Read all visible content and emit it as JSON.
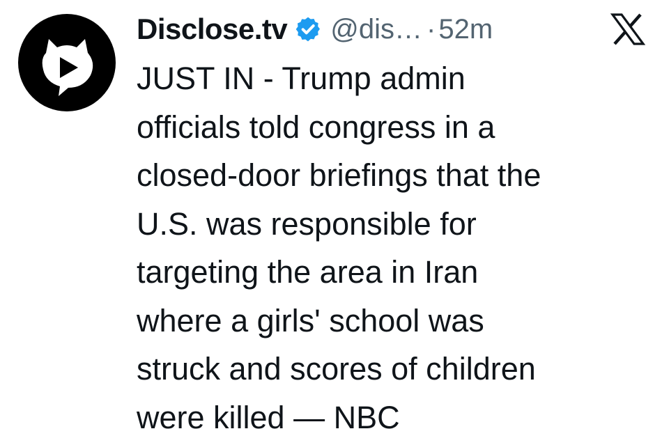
{
  "tweet": {
    "author": {
      "display_name": "Disclose.tv",
      "handle": "@dis…",
      "verified": true,
      "avatar_icon": "disclose-tv-logo"
    },
    "separator": "·",
    "timestamp": "52m",
    "platform_icon": "x-logo-icon",
    "text_lines": [
      "JUST IN - Trump admin",
      "officials told congress in a",
      "closed-door briefings that the",
      "U.S. was responsible for",
      "targeting the area in Iran",
      "where a girls' school was",
      "struck and scores of children",
      "were killed — NBC"
    ]
  },
  "colors": {
    "text_primary": "#0f1419",
    "text_secondary": "#536471",
    "verified_badge": "#1d9bf0",
    "avatar_bg": "#000000"
  }
}
